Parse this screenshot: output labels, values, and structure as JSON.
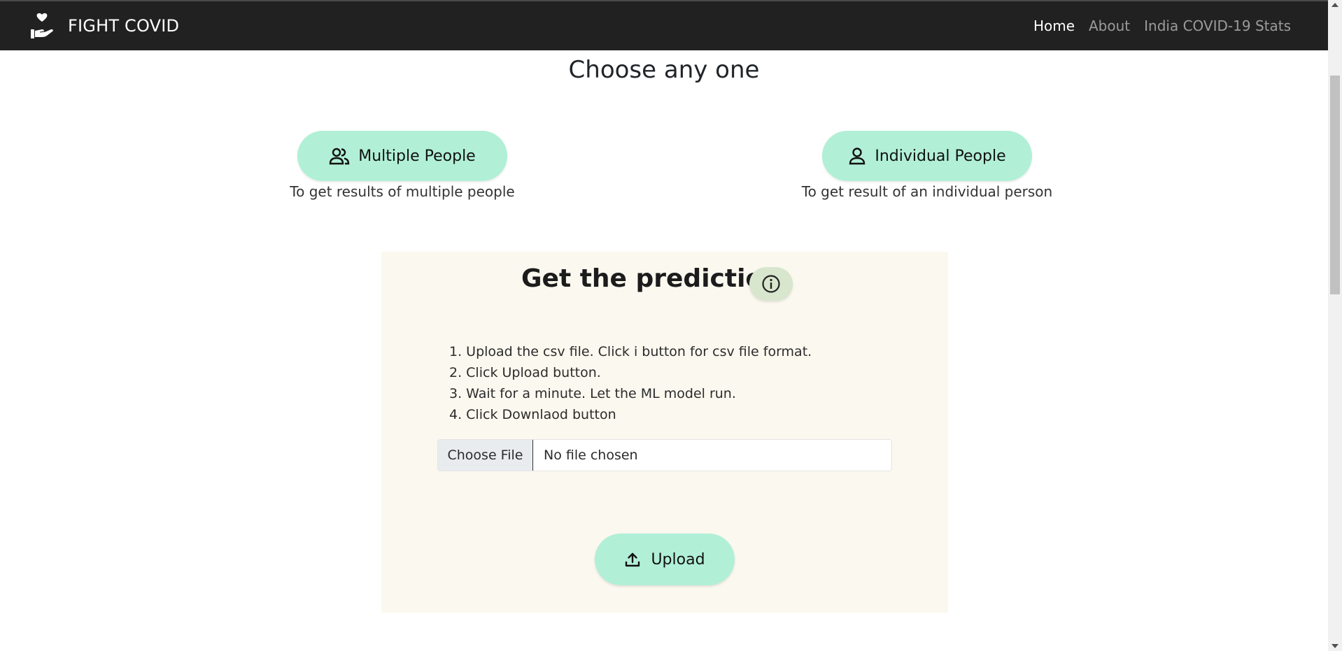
{
  "navbar": {
    "brand": "FIGHT COVID",
    "brand_icon": "hand-holding-heart-icon",
    "links": [
      {
        "label": "Home",
        "active": true
      },
      {
        "label": "About",
        "active": false
      },
      {
        "label": "India COVID-19 Stats",
        "active": false
      }
    ]
  },
  "main": {
    "heading": "Choose any one",
    "options": [
      {
        "label": "Multiple People",
        "icon": "people-icon",
        "caption": "To get results of multiple people"
      },
      {
        "label": "Individual People",
        "icon": "person-icon",
        "caption": "To get result of an individual person"
      }
    ]
  },
  "prediction": {
    "title": "Get the prediction",
    "info_icon": "info-icon",
    "steps": [
      "1. Upload the csv file. Click i button for csv file format.",
      "2. Click Upload button.",
      "3. Wait for a minute. Let the ML model run.",
      "4. Click Downlaod button"
    ],
    "file_input": {
      "button_label": "Choose File",
      "status": "No file chosen"
    },
    "upload_label": "Upload",
    "upload_icon": "upload-icon"
  },
  "colors": {
    "navbar_bg": "#212121",
    "button_accent": "#b1f0d6",
    "card_bg": "#fbf8ef",
    "info_button_bg": "#d8e6cd"
  }
}
